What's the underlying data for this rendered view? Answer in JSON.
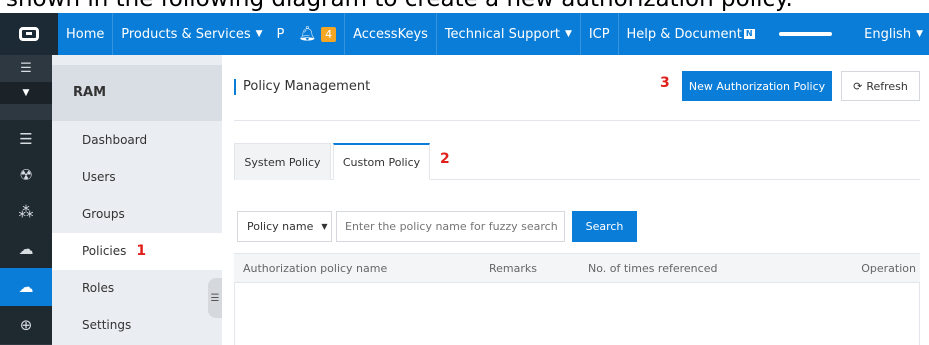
{
  "caption": "shown in the following diagram to create a new authorization policy.",
  "topbar": {
    "items": [
      {
        "label": "Home"
      },
      {
        "label": "Products & Services"
      },
      {
        "label": "P"
      },
      {
        "label": "AccessKeys"
      },
      {
        "label": "Technical Support"
      },
      {
        "label": "ICP"
      },
      {
        "label": "Help & Document"
      },
      {
        "label": "English"
      }
    ],
    "notification_count": "4",
    "doc_badge": "N"
  },
  "rail": {
    "icons": [
      "menu-icon",
      "server-icon",
      "brain-icon",
      "nodes-icon",
      "cloud-upload-icon",
      "cloud-active-icon",
      "globe-icon"
    ]
  },
  "sidebar": {
    "title": "RAM",
    "items": [
      {
        "label": "Dashboard"
      },
      {
        "label": "Users"
      },
      {
        "label": "Groups"
      },
      {
        "label": "Policies",
        "mark": "1"
      },
      {
        "label": "Roles"
      },
      {
        "label": "Settings"
      }
    ]
  },
  "main": {
    "title": "Policy Management",
    "step3": "3",
    "new_policy_label": "New Authorization Policy",
    "refresh_label": "Refresh",
    "tabs": [
      {
        "label": "System Policy"
      },
      {
        "label": "Custom Policy"
      }
    ],
    "step2": "2",
    "search_select_value": "Policy name",
    "search_placeholder": "Enter the policy name for fuzzy search",
    "search_label": "Search",
    "table_headers": [
      "Authorization policy name",
      "Remarks",
      "No. of times referenced",
      "Operation"
    ]
  },
  "colors": {
    "topbar": "#0a7dd8",
    "rail": "#2d3840",
    "accent": "#0a7dd8",
    "annotation": "#e0201b"
  }
}
